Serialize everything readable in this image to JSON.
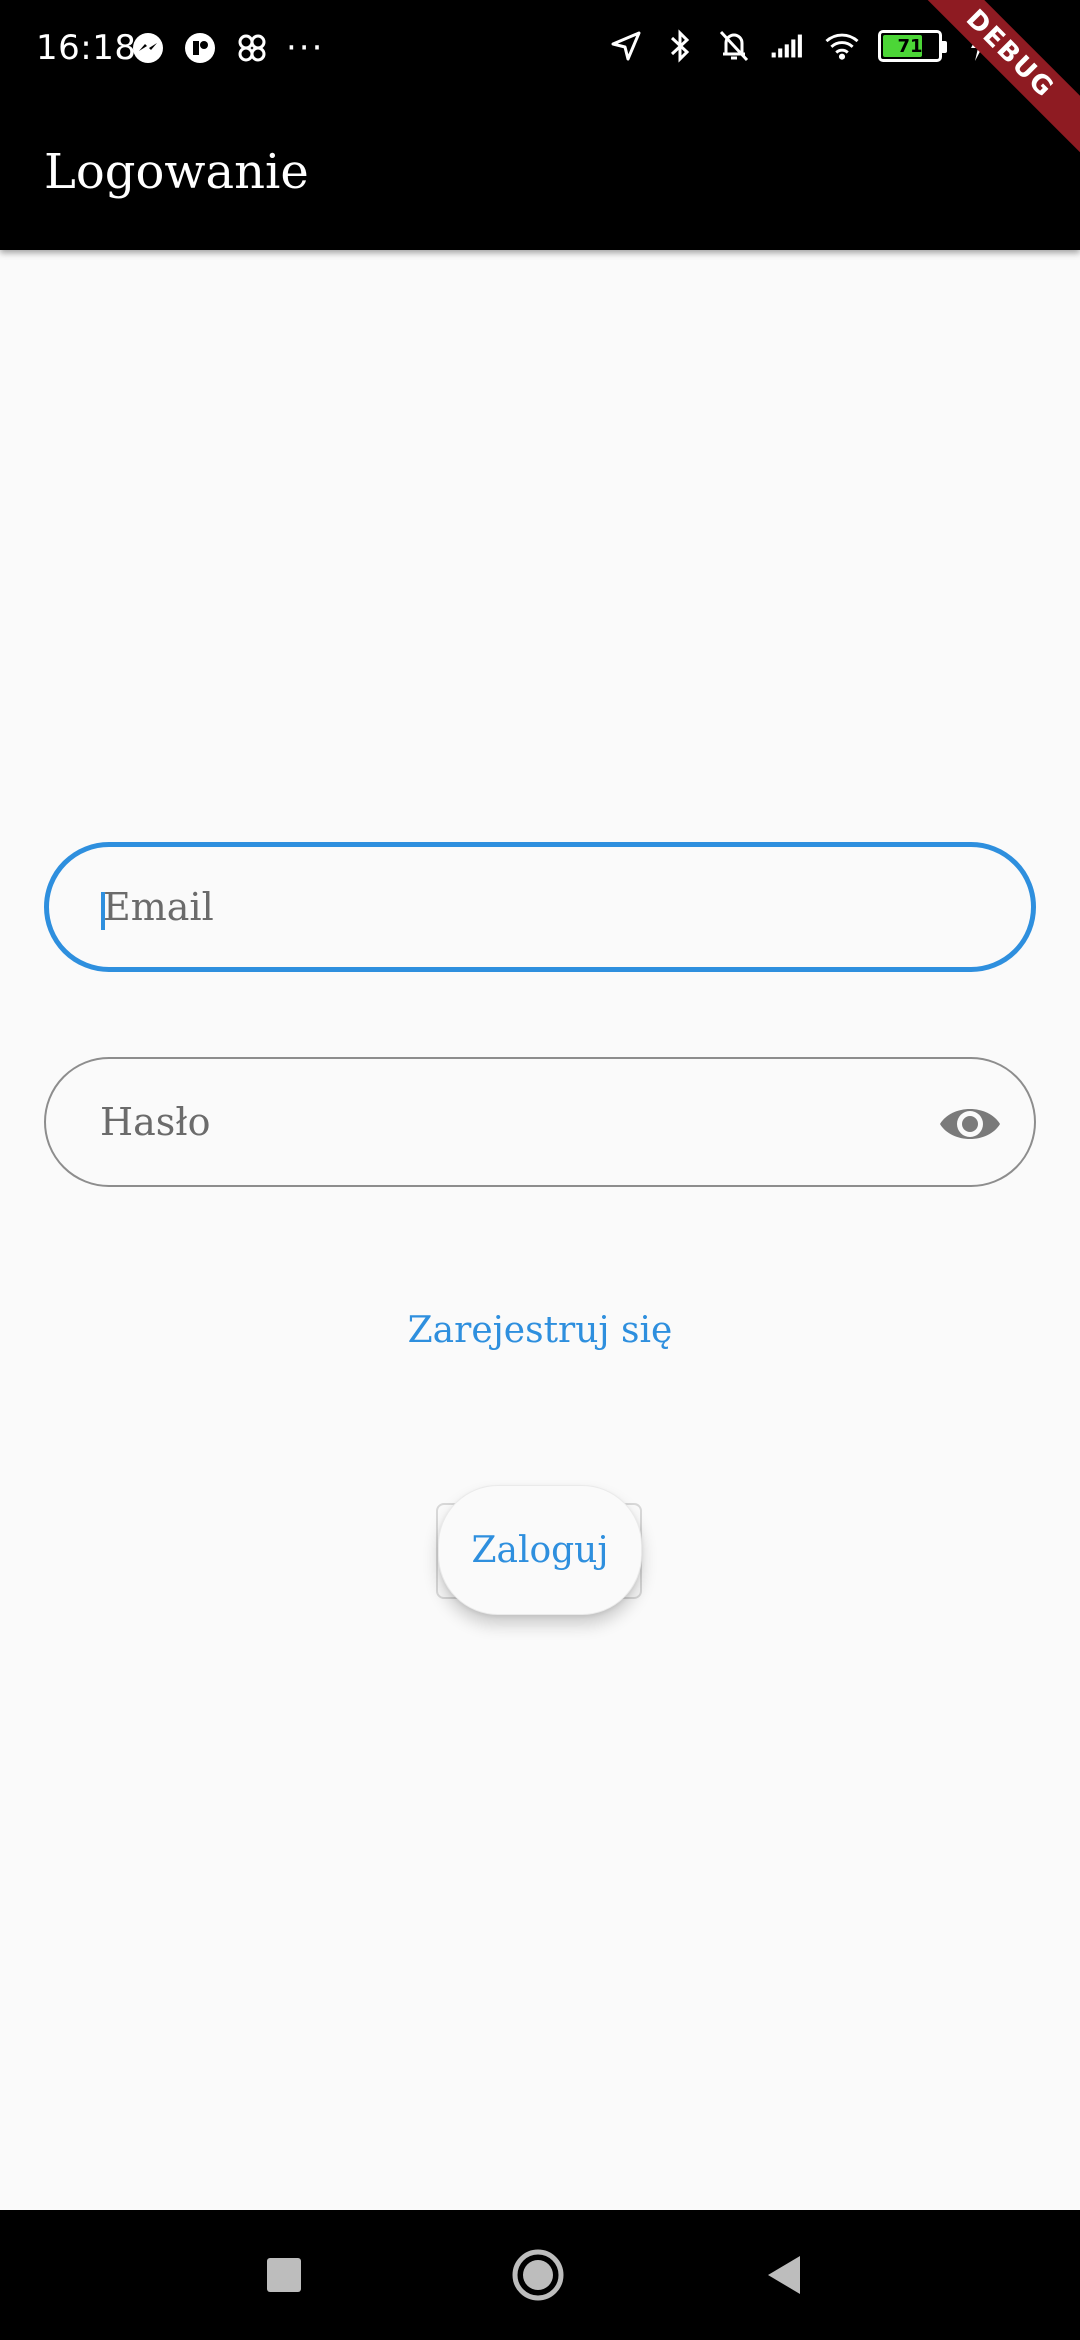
{
  "status_bar": {
    "time": "16:18",
    "left_icons": [
      "messenger-icon",
      "app-notification-icon",
      "pinwheel-icon"
    ],
    "more_indicator": "···",
    "right_icons": [
      "location-arrow-icon",
      "bluetooth-icon",
      "bell-muted-icon",
      "signal-icon",
      "wifi-icon",
      "battery-icon",
      "charging-icon"
    ],
    "battery_level": "71",
    "battery_color": "#4cd637"
  },
  "debug_banner": {
    "label": "DEBUG",
    "color": "#8e1b22"
  },
  "app_bar": {
    "title": "Logowanie"
  },
  "form": {
    "email": {
      "placeholder": "Email",
      "value": ""
    },
    "password": {
      "placeholder": "Hasło",
      "value": "",
      "toggle_icon": "eye-icon"
    },
    "register_link": "Zarejestruj się",
    "login_button": "Zaloguj"
  },
  "nav_bar": {
    "buttons": [
      "recents-square-icon",
      "home-circle-icon",
      "back-triangle-icon"
    ]
  },
  "colors": {
    "accent": "#2e8fde",
    "background": "#fafafa",
    "app_bar": "#000000"
  }
}
